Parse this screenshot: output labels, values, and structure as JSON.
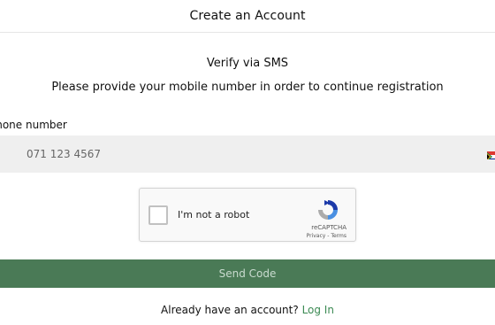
{
  "header": {
    "title": "Create an Account"
  },
  "verify": {
    "title": "Verify via SMS",
    "subtitle": "Please provide your mobile number in order to continue registration"
  },
  "phone": {
    "label": "Phone number",
    "placeholder": "071 123 4567",
    "value": "",
    "country_flag_icon": "south-africa-flag-icon"
  },
  "captcha": {
    "checkbox_label": "I'm not a robot",
    "brand": "reCAPTCHA",
    "privacy": "Privacy",
    "separator": " - ",
    "terms": "Terms",
    "checked": false
  },
  "actions": {
    "send_code": "Send Code"
  },
  "footer": {
    "prompt": "Already have an account?",
    "login_link": "Log In"
  },
  "colors": {
    "primary_button": "#4a7a56",
    "link": "#3b8a53",
    "input_bg": "#efefef"
  }
}
